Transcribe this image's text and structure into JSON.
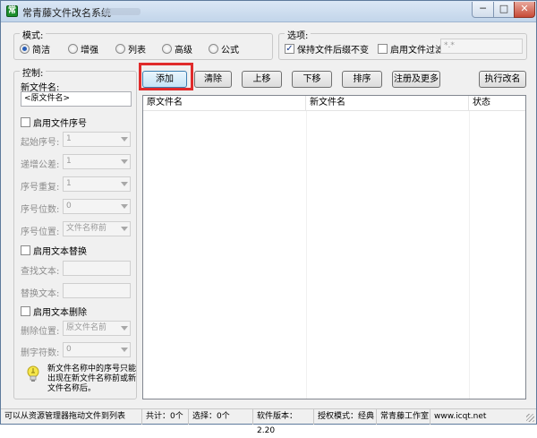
{
  "window": {
    "title": "常青藤文件改名系统",
    "app_icon_glyph": "常",
    "minimize": "─",
    "maximize": "□",
    "close": "✕"
  },
  "mode": {
    "title": "模式:",
    "options": [
      "简洁",
      "增强",
      "列表",
      "高级",
      "公式"
    ],
    "selected": "简洁"
  },
  "options": {
    "title": "选项:",
    "keep_ext_label": "保持文件后缀不变",
    "keep_ext_checked": true,
    "filter_label": "启用文件过滤",
    "filter_checked": false,
    "filter_value": "*.*"
  },
  "control": {
    "title": "控制:",
    "new_name_label": "新文件名:",
    "new_name_value": "<原文件名>",
    "seq_enable_label": "启用文件序号",
    "start_label": "起始序号:",
    "start_value": "1",
    "step_label": "递增公差:",
    "step_value": "1",
    "repeat_label": "序号重复:",
    "repeat_value": "1",
    "digits_label": "序号位数:",
    "digits_value": "0",
    "pos_label": "序号位置:",
    "pos_value": "文件名称前",
    "replace_enable_label": "启用文本替换",
    "find_label": "查找文本:",
    "replace_label": "替换文本:",
    "delete_enable_label": "启用文本删除",
    "del_pos_label": "删除位置:",
    "del_pos_value": "原文件名前",
    "del_count_label": "删字符数:",
    "del_count_value": "0",
    "note": "新文件名称中的序号只能出现在新文件名称前或新文件名称后。"
  },
  "toolbar": {
    "add": "添加",
    "clear": "清除",
    "up": "上移",
    "down": "下移",
    "sort": "排序",
    "register": "注册及更多",
    "execute": "执行改名"
  },
  "table": {
    "columns": [
      "原文件名",
      "新文件名",
      "状态"
    ],
    "rows": []
  },
  "statusbar": {
    "hint": "可以从资源管理器拖动文件到列表",
    "total": "共计：0个",
    "selected": "选择：0个",
    "version": "软件版本：2.20",
    "license": "授权模式：经典",
    "studio": "常青藤工作室",
    "website": "www.icqt.net"
  },
  "colors": {
    "highlight_border": "#e02b2b",
    "title_gradient_top": "#dbe7f5",
    "close_button": "#c74a36"
  }
}
